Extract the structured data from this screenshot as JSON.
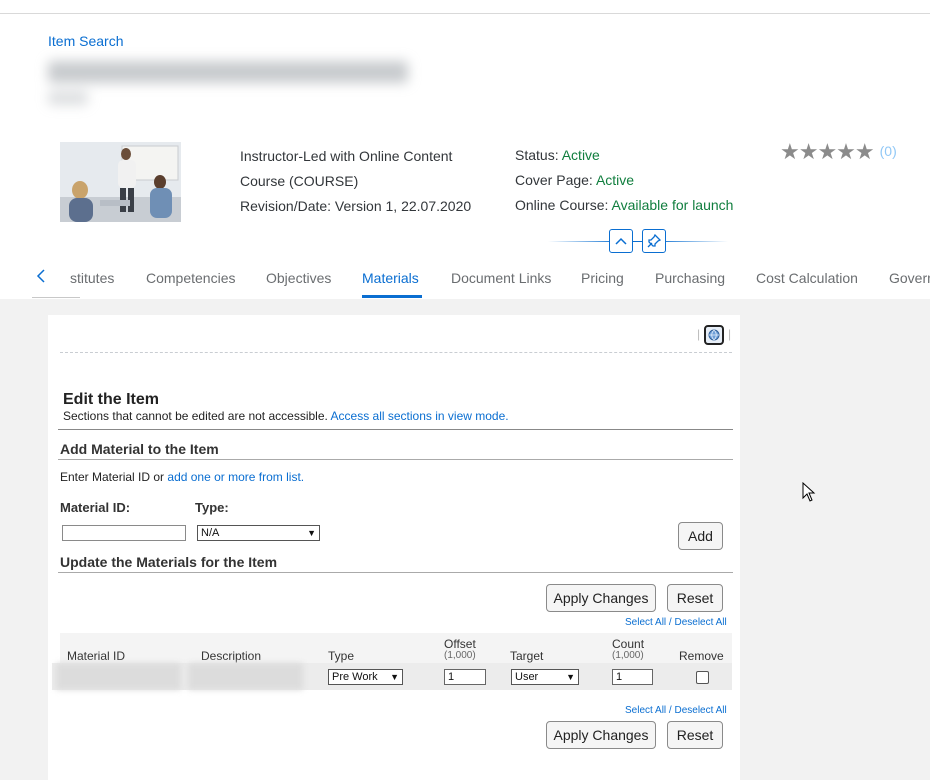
{
  "breadcrumb": {
    "label": "Item Search"
  },
  "header": {
    "delivery": "Instructor-Led with Online Content",
    "item_type": "Course (COURSE)",
    "revision": "Revision/Date: Version 1, 22.07.2020",
    "status_label": "Status:",
    "status_value": "Active",
    "cover_label": "Cover Page:",
    "cover_value": "Active",
    "online_label": "Online Course:",
    "online_value": "Available for launch",
    "rating_stars": "★★★★★",
    "rating_count": "(0)",
    "status_color": "#107e3e"
  },
  "tabs": [
    {
      "label": "stitutes"
    },
    {
      "label": "Competencies"
    },
    {
      "label": "Objectives"
    },
    {
      "label": "Materials",
      "active": true
    },
    {
      "label": "Document Links"
    },
    {
      "label": "Pricing"
    },
    {
      "label": "Purchasing"
    },
    {
      "label": "Cost Calculation"
    },
    {
      "label": "Govern"
    }
  ],
  "edit": {
    "title": "Edit the Item",
    "subtitle": "Sections that cannot be edited are not accessible.",
    "subtitle_link": "Access all sections in view mode."
  },
  "add_material": {
    "heading": "Add Material to the Item",
    "intro": "Enter Material ID or",
    "intro_link": "add one or more from list.",
    "material_id_label": "Material ID:",
    "type_label": "Type:",
    "material_id_value": "",
    "type_value": "N/A",
    "add_button": "Add"
  },
  "update": {
    "heading": "Update the Materials for the Item",
    "apply_button": "Apply Changes",
    "reset_button": "Reset",
    "select_all": "Select All",
    "separator": "/",
    "deselect_all": "Deselect All",
    "columns": {
      "material_id": "Material ID",
      "description": "Description",
      "type": "Type",
      "offset": "Offset",
      "offset_sub": "(1,000)",
      "target": "Target",
      "count": "Count",
      "count_sub": "(1,000)",
      "remove": "Remove"
    },
    "row": {
      "type": "Pre Work",
      "offset": "1",
      "target": "User",
      "count": "1",
      "remove": false
    }
  },
  "accent_color": "#0a6ed1"
}
